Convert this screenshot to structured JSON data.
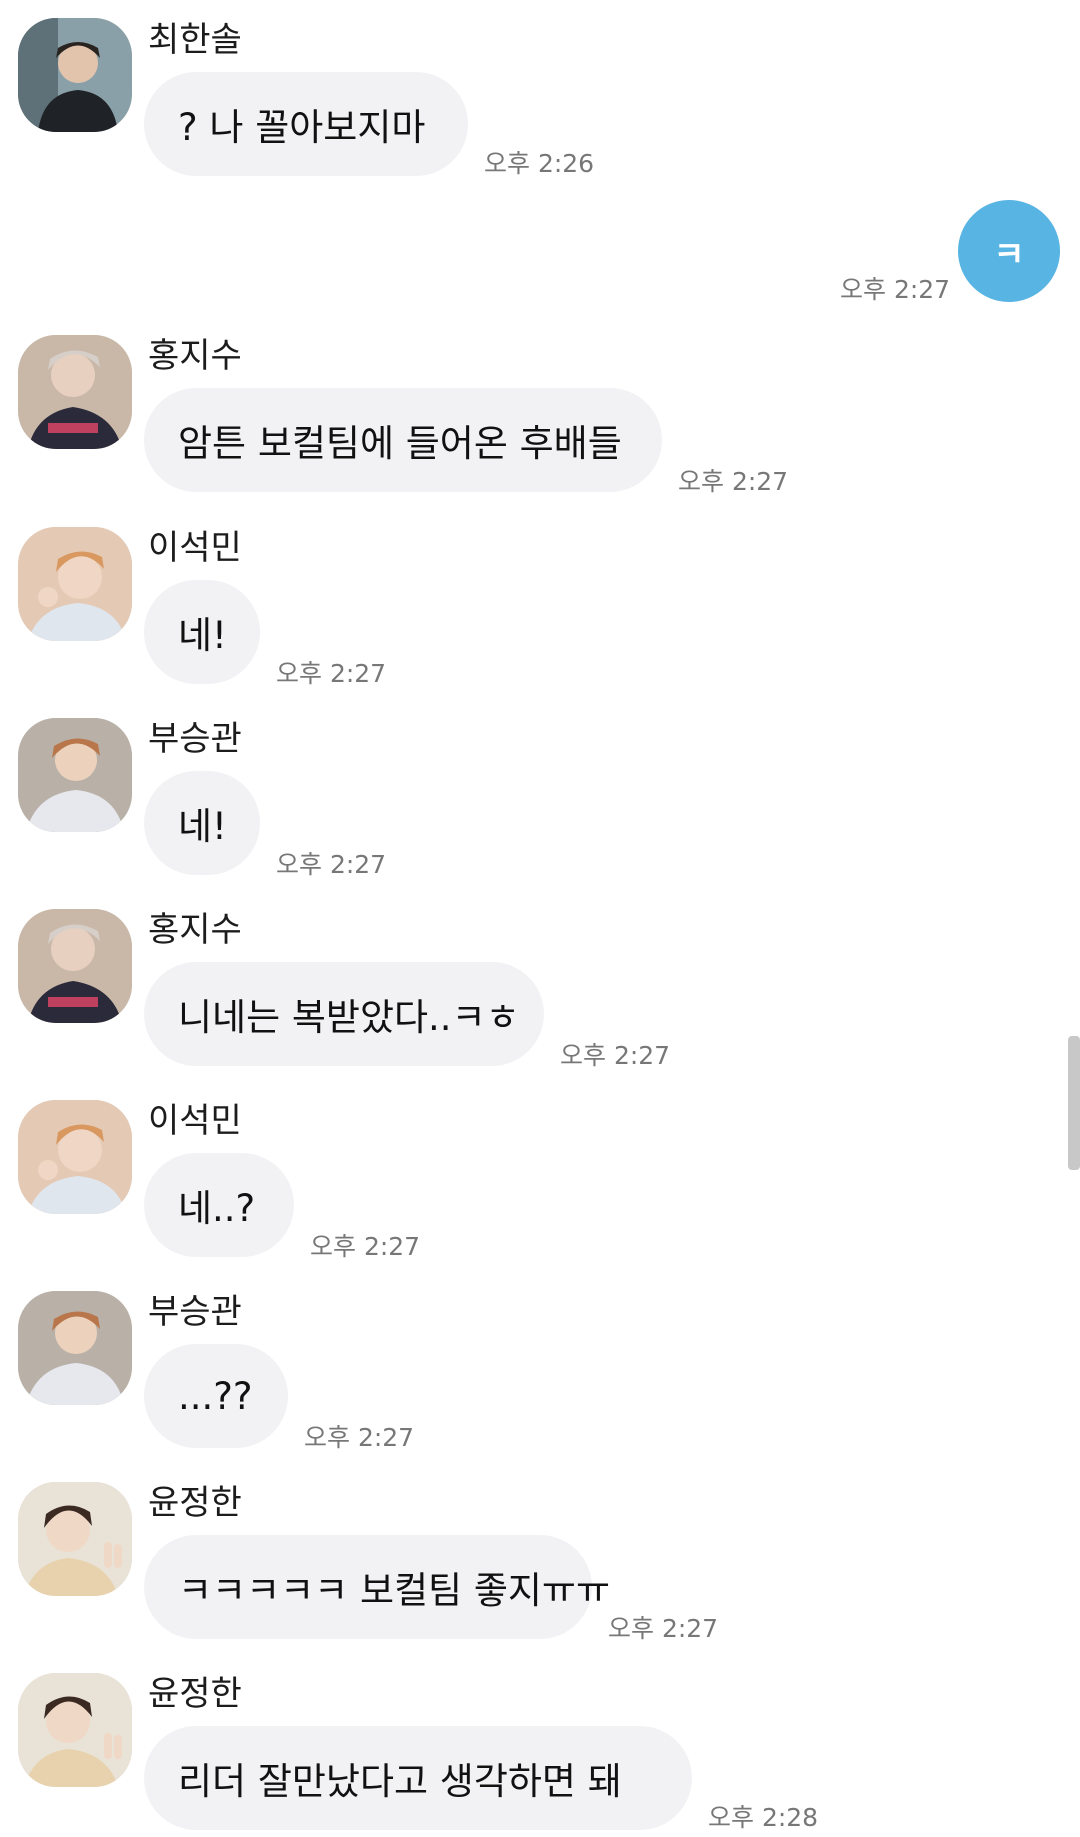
{
  "messages": [
    {
      "sender": "최한솔",
      "text": "? 나 꼴아보지마",
      "time": "오후 2:26"
    },
    {
      "text": "ㅋ",
      "time": "오후 2:27"
    },
    {
      "sender": "홍지수",
      "text": "암튼 보컬팀에 들어온 후배들",
      "time": "오후 2:27"
    },
    {
      "sender": "이석민",
      "text": "네!",
      "time": "오후 2:27"
    },
    {
      "sender": "부승관",
      "text": "네!",
      "time": "오후 2:27"
    },
    {
      "sender": "홍지수",
      "text": "니네는 복받았다..ㅋㅎ",
      "time": "오후 2:27"
    },
    {
      "sender": "이석민",
      "text": "네..?",
      "time": "오후 2:27"
    },
    {
      "sender": "부승관",
      "text": "...??",
      "time": "오후 2:27"
    },
    {
      "sender": "윤정한",
      "text": "ㅋㅋㅋㅋㅋ 보컬팀 좋지ㅠㅠ",
      "time": "오후 2:27"
    },
    {
      "sender": "윤정한",
      "text": "리더 잘만났다고 생각하면 돼",
      "time": "오후 2:28"
    }
  ],
  "colors": {
    "my_bubble": "#58b4e2",
    "other_bubble": "#f2f2f5",
    "time_text": "#777777"
  }
}
